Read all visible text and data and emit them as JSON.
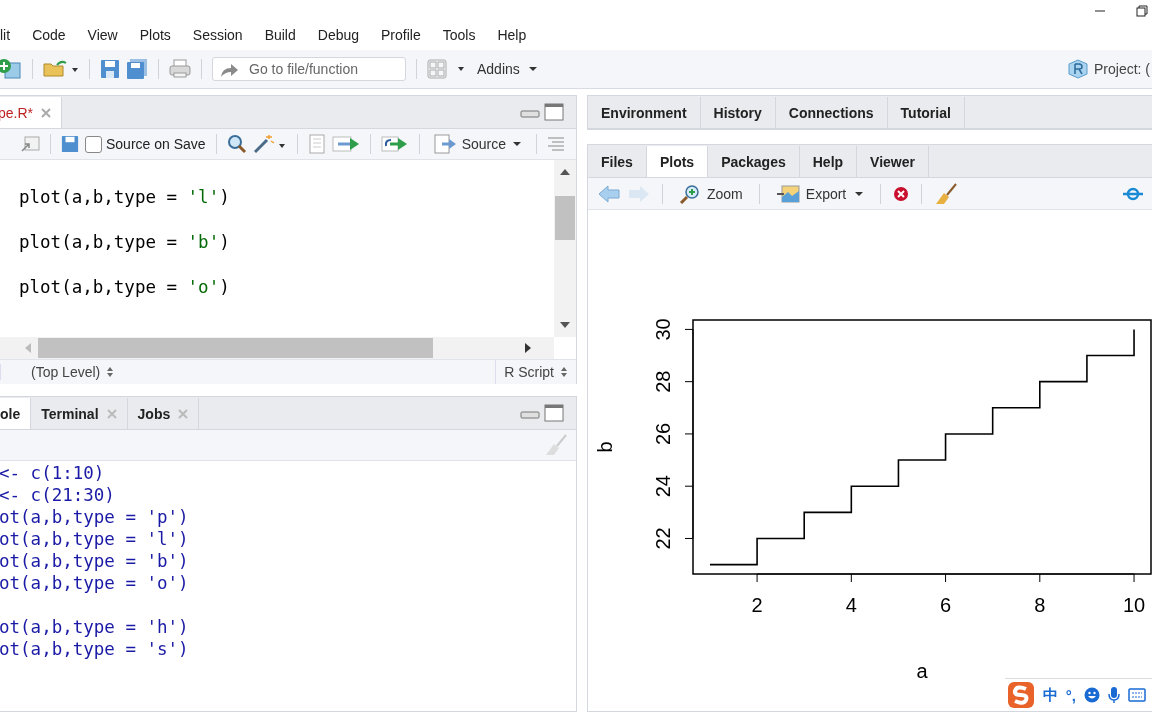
{
  "menu": [
    "lit",
    "Code",
    "View",
    "Plots",
    "Session",
    "Build",
    "Debug",
    "Profile",
    "Tools",
    "Help"
  ],
  "toolbar": {
    "goto_placeholder": "Go to file/function",
    "addins": "Addins",
    "project": "Project: ("
  },
  "source_pane": {
    "tab": {
      "label": "pe.R*",
      "selected": true
    },
    "source_on_save": {
      "label": "Source on Save",
      "checked": false
    },
    "source_button": "Source",
    "lines": [
      [
        {
          "text": "plot(a,b,type = ",
          "kind": "plain"
        },
        {
          "text": "'l'",
          "kind": "string"
        },
        {
          "text": ")",
          "kind": "plain"
        }
      ],
      [
        {
          "text": "plot(a,b,type = ",
          "kind": "plain"
        },
        {
          "text": "'b'",
          "kind": "string"
        },
        {
          "text": ")",
          "kind": "plain"
        }
      ],
      [
        {
          "text": "plot(a,b,type = ",
          "kind": "plain"
        },
        {
          "text": "'o'",
          "kind": "string"
        },
        {
          "text": ")",
          "kind": "plain"
        }
      ]
    ],
    "status": {
      "scope": "(Top Level)",
      "filetype": "R Script"
    }
  },
  "console_pane": {
    "tabs": [
      {
        "label": "ole",
        "selected": true,
        "closable": false
      },
      {
        "label": "Terminal",
        "selected": false,
        "closable": true
      },
      {
        "label": "Jobs",
        "selected": false,
        "closable": true
      }
    ],
    "blocks": [
      [
        "<- c(1:10)",
        "<- c(21:30)",
        "ot(a,b,type = 'p')",
        "ot(a,b,type = 'l')",
        "ot(a,b,type = 'b')",
        "ot(a,b,type = 'o')"
      ],
      [
        "ot(a,b,type = 'h')",
        "ot(a,b,type = 's')"
      ]
    ]
  },
  "top_right_pane": {
    "tabs": [
      {
        "label": "Environment",
        "selected": false
      },
      {
        "label": "History",
        "selected": false
      },
      {
        "label": "Connections",
        "selected": false
      },
      {
        "label": "Tutorial",
        "selected": false
      }
    ]
  },
  "plots_pane": {
    "tabs": [
      {
        "label": "Files",
        "selected": false
      },
      {
        "label": "Plots",
        "selected": true
      },
      {
        "label": "Packages",
        "selected": false
      },
      {
        "label": "Help",
        "selected": false
      },
      {
        "label": "Viewer",
        "selected": false
      }
    ],
    "zoom": "Zoom",
    "export": "Export",
    "chart_data": {
      "type": "line",
      "xlabel": "a",
      "ylabel": "b",
      "x": [
        1,
        2,
        2,
        3,
        3,
        4,
        4,
        5,
        5,
        6,
        6,
        7,
        7,
        8,
        8,
        9,
        9,
        10,
        10
      ],
      "series": [
        {
          "color": "#000000",
          "values": [
            21,
            21,
            22,
            22,
            23,
            23,
            24,
            24,
            25,
            25,
            26,
            26,
            27,
            27,
            28,
            28,
            29,
            29,
            30
          ]
        }
      ],
      "xlim": [
        0.64,
        10.36
      ],
      "ylim": [
        20.64,
        30.36
      ],
      "xticks": [
        2,
        4,
        6,
        8,
        10
      ],
      "yticks": [
        22,
        24,
        26,
        28,
        30
      ]
    }
  },
  "ime": {
    "language": "中",
    "punctuation": "°,"
  }
}
